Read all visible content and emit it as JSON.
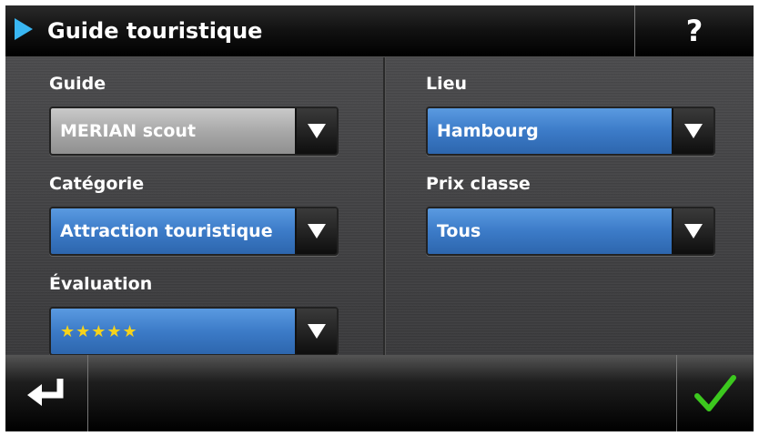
{
  "header": {
    "title": "Guide touristique",
    "help_label": "?",
    "accent": "#39b6f2"
  },
  "fields": {
    "guide": {
      "label": "Guide",
      "value": "MERIAN scout"
    },
    "lieu": {
      "label": "Lieu",
      "value": "Hambourg"
    },
    "categorie": {
      "label": "Catégorie",
      "value": "Attraction touristique"
    },
    "prix": {
      "label": "Prix classe",
      "value": "Tous"
    },
    "evaluation": {
      "label": "Évaluation",
      "value": "★★★★★",
      "stars": 5
    }
  },
  "footer": {
    "back_icon": "return-arrow-icon",
    "confirm_icon": "checkmark-icon",
    "confirm_color": "#3cc81e"
  },
  "colors": {
    "combo_active": "#3c7bc8",
    "combo_disabled": "#a9a9a9",
    "star": "#f7d31b"
  }
}
